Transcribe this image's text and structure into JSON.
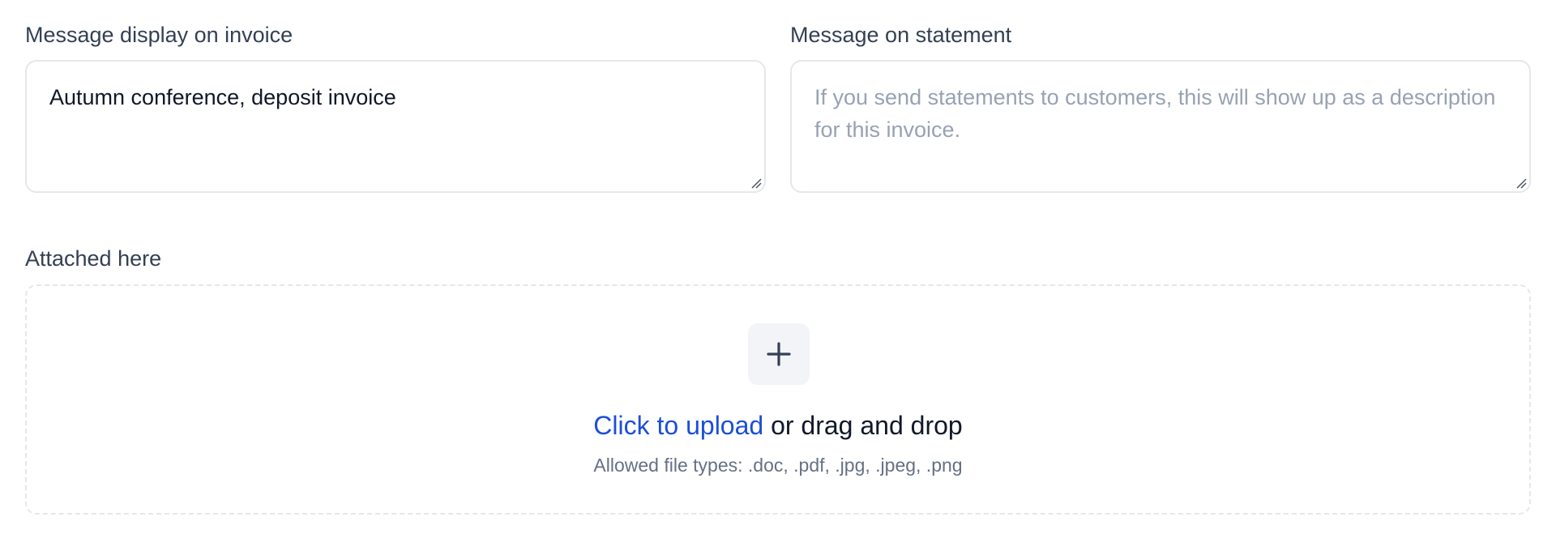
{
  "invoice_message": {
    "label": "Message display on invoice",
    "value": "Autumn conference, deposit invoice"
  },
  "statement_message": {
    "label": "Message on statement",
    "placeholder": "If you send statements to customers, this will show up as a description for this invoice."
  },
  "attachments": {
    "label": "Attached here",
    "upload_link": "Click to upload",
    "upload_suffix": " or drag and drop",
    "allowed_types": "Allowed file types: .doc, .pdf, .jpg, .jpeg, .png",
    "icon": "plus-icon"
  },
  "colors": {
    "link": "#1d4ed8",
    "label": "#344054",
    "placeholder": "#98a2b3",
    "border": "#e5e7eb",
    "tile": "#f2f4f7"
  }
}
